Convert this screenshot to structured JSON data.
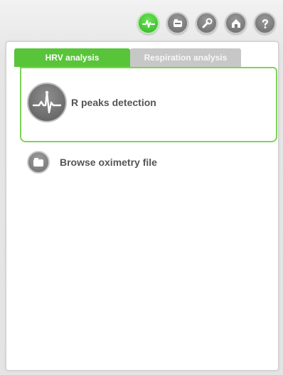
{
  "toolbar": {
    "buttons": [
      {
        "icon": "heartbeat-icon",
        "active": true
      },
      {
        "icon": "folder-icon",
        "active": false
      },
      {
        "icon": "wrench-icon",
        "active": false
      },
      {
        "icon": "home-icon",
        "active": false
      },
      {
        "icon": "help-icon",
        "active": false
      }
    ]
  },
  "tabs": [
    {
      "label": "HRV analysis",
      "active": true
    },
    {
      "label": "Respiration analysis",
      "active": false
    }
  ],
  "card": {
    "icon": "ecg-icon",
    "label": "R peaks detection"
  },
  "browse": {
    "icon": "folder-icon",
    "label": "Browse oximetry file"
  },
  "colors": {
    "accent_green": "#58c43a",
    "card_border": "#7dd456",
    "inactive_tab": "#c7c7c7",
    "text": "#555555"
  }
}
